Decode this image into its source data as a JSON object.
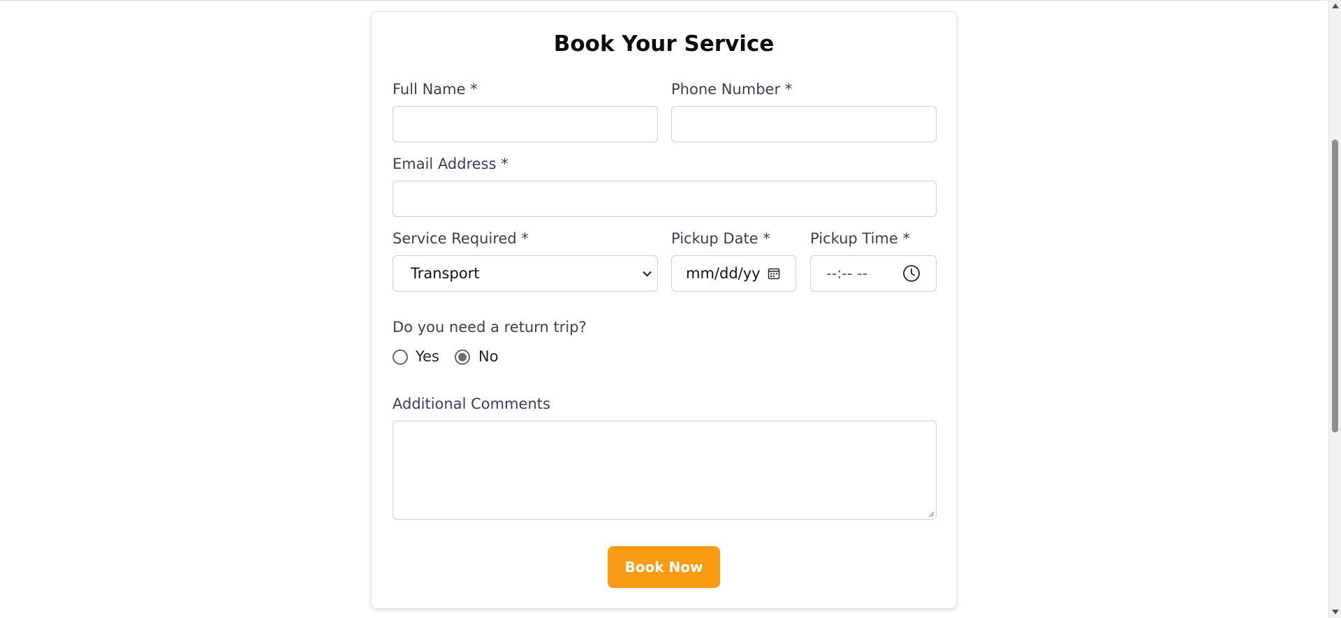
{
  "form": {
    "title": "Book Your Service",
    "full_name": {
      "label": "Full Name *",
      "value": ""
    },
    "phone": {
      "label": "Phone Number *",
      "value": ""
    },
    "email": {
      "label": "Email Address *",
      "value": ""
    },
    "service": {
      "label": "Service Required *",
      "selected": "Transport"
    },
    "pickup_date": {
      "label": "Pickup Date *",
      "placeholder": "mm/dd/yy"
    },
    "pickup_time": {
      "label": "Pickup Time *",
      "placeholder": "--:-- --"
    },
    "return_trip": {
      "question": "Do you need a return trip?",
      "options": [
        "Yes",
        "No"
      ],
      "selected": "No"
    },
    "comments": {
      "label": "Additional Comments",
      "value": ""
    },
    "submit_label": "Book Now"
  },
  "colors": {
    "accent": "#fa9b14",
    "label_text": "#3a3f4a",
    "border": "#cfcfcf"
  }
}
